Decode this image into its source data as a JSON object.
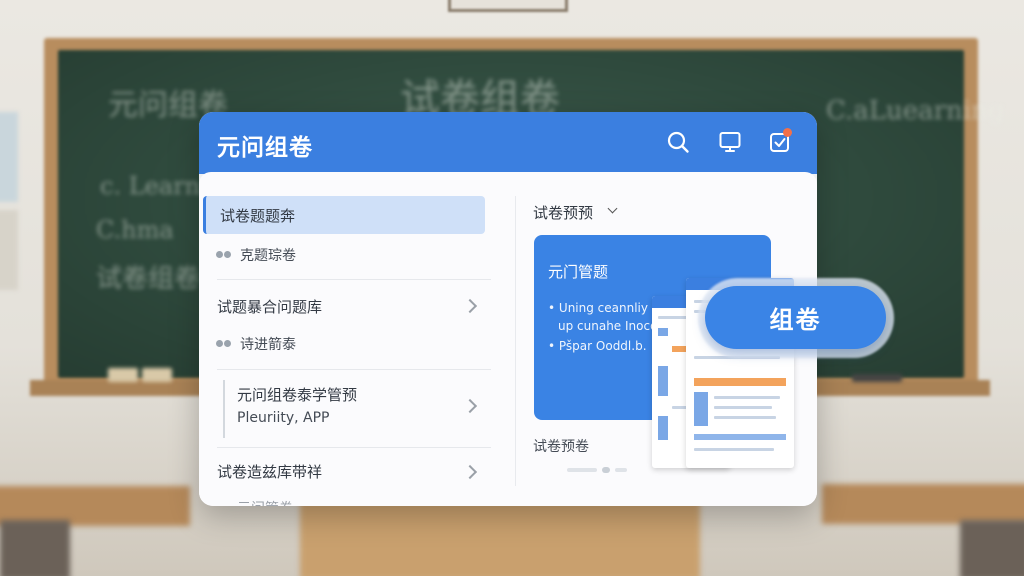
{
  "background": {
    "board_lines": [
      "元问组卷",
      "试卷组卷",
      "c. Learning",
      "C.hma",
      "C.aLuearning",
      "试卷组卷"
    ]
  },
  "header": {
    "title": "元问组卷",
    "icons": [
      "search-icon",
      "monitor-icon",
      "notification-icon"
    ],
    "accent": "#3b7fe0"
  },
  "sidebar": {
    "items": [
      {
        "label": "试卷题题奔",
        "active": true
      },
      {
        "label": "克题琮卷",
        "type": "sub"
      },
      {
        "label": "试题暴合问题库",
        "has_chevron": true
      },
      {
        "label": "诗进箭泰",
        "type": "sub"
      },
      {
        "label": "元问组卷泰学管预",
        "sublabel": "Pleuriity, APP",
        "has_chevron": true
      },
      {
        "label": "试卷造兹库带祥",
        "has_chevron": true
      },
      {
        "label": "元问管卷"
      }
    ]
  },
  "preview": {
    "heading": "试卷预预",
    "card_title": "元门管题",
    "bullets": [
      "Uning ceannliy a",
      "up cunahe Inocoo",
      "Pšpar Ooddl.b."
    ],
    "footer": "试卷预卷"
  },
  "compose_button": {
    "label": "组卷"
  }
}
